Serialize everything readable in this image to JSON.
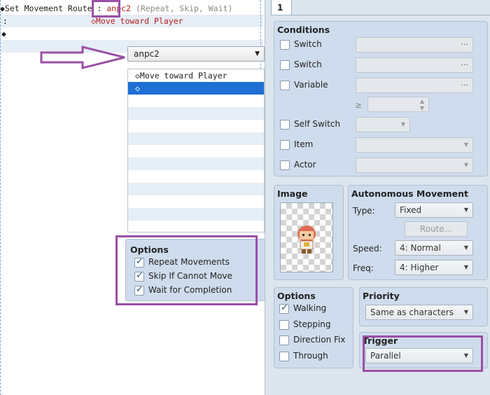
{
  "command_list": {
    "line1": {
      "prefix": "◆Set Movement Route :",
      "target": "anpc2",
      "params": "(Repeat, Skip, Wait)"
    },
    "line2": {
      "prefix": ":",
      "content": "◇Move toward Player"
    },
    "line3": "◆"
  },
  "route_dialog": {
    "target_value": "anpc2",
    "list_items": [
      "◇Move toward Player",
      "◇"
    ],
    "options": {
      "title": "Options",
      "repeat_label": "Repeat Movements",
      "repeat_checked": true,
      "skip_label": "Skip If Cannot Move",
      "skip_checked": true,
      "wait_label": "Wait for Completion",
      "wait_checked": true
    }
  },
  "event_panel": {
    "page_tab": "1",
    "conditions": {
      "title": "Conditions",
      "switch1": "Switch",
      "switch2": "Switch",
      "variable": "Variable",
      "gte": "≥",
      "self_switch": "Self Switch",
      "item": "Item",
      "actor": "Actor",
      "dots": "···"
    },
    "image": {
      "title": "Image"
    },
    "autonomous": {
      "title": "Autonomous Movement",
      "type_label": "Type:",
      "type_value": "Fixed",
      "route_button": "Route...",
      "speed_label": "Speed:",
      "speed_value": "4: Normal",
      "freq_label": "Freq:",
      "freq_value": "4: Higher"
    },
    "options": {
      "title": "Options",
      "walking": "Walking",
      "walking_checked": true,
      "stepping": "Stepping",
      "direction_fix": "Direction Fix",
      "through": "Through"
    },
    "priority": {
      "title": "Priority",
      "value": "Same as characters"
    },
    "trigger": {
      "title": "Trigger",
      "value": "Parallel"
    }
  },
  "colors": {
    "annotation": "#9b4fa6",
    "selection": "#1e6fd4",
    "panel_bg": "#cfdced"
  }
}
